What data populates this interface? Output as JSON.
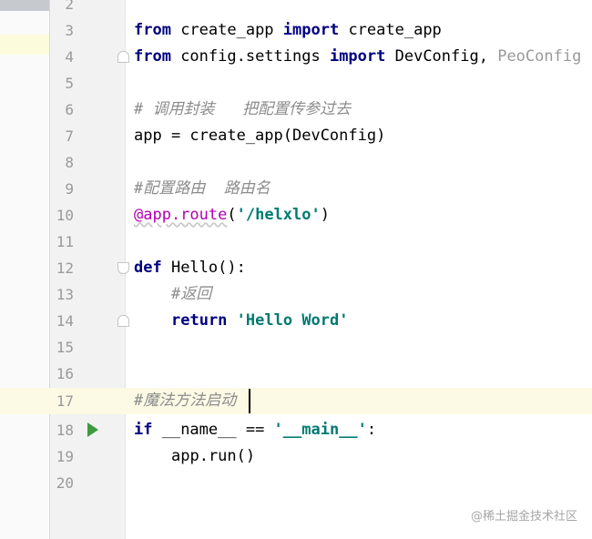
{
  "editor": {
    "lines": [
      {
        "num": "2"
      },
      {
        "num": "3",
        "parts": [
          "from",
          " create_app ",
          "import",
          " create_app"
        ]
      },
      {
        "num": "4",
        "parts": [
          "from",
          " config.settings ",
          "import",
          " DevConfig, ",
          "PeoConfig"
        ]
      },
      {
        "num": "5"
      },
      {
        "num": "6",
        "parts": [
          "# 调用封装   把配置传参过去"
        ]
      },
      {
        "num": "7",
        "parts": [
          "app = create_app(DevConfig)"
        ]
      },
      {
        "num": "8"
      },
      {
        "num": "9",
        "parts": [
          "#配置路由  路由名"
        ]
      },
      {
        "num": "10",
        "parts": [
          "@app.route",
          "(",
          "'/helxlo'",
          ")"
        ]
      },
      {
        "num": "11"
      },
      {
        "num": "12",
        "parts": [
          "def",
          " Hello():"
        ]
      },
      {
        "num": "13",
        "parts": [
          "#返回"
        ]
      },
      {
        "num": "14",
        "parts": [
          "return",
          " ",
          "'Hello Word'"
        ]
      },
      {
        "num": "15"
      },
      {
        "num": "16"
      },
      {
        "num": "17",
        "parts": [
          "#魔法方法启动"
        ]
      },
      {
        "num": "18",
        "parts": [
          "if",
          " __name__ == ",
          "'__main__'",
          ":"
        ]
      },
      {
        "num": "19",
        "parts": [
          "app.run()"
        ]
      },
      {
        "num": "20"
      }
    ]
  },
  "icons": {
    "run": "run-triangle-icon",
    "fold": "fold-marker-icon"
  },
  "colors": {
    "keyword": "#000080",
    "string": "#007a72",
    "comment": "#8c8c8c",
    "decorator": "#b200b2",
    "current_line": "#fcfae5",
    "run_icon": "#3c9b3c"
  },
  "watermark": "@稀土掘金技术社区"
}
